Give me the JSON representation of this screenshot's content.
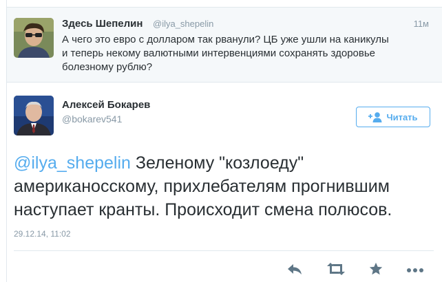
{
  "parent_tweet": {
    "display_name": "Здесь Шепелин",
    "handle": "@ilya_shepelin",
    "time": "11м",
    "text_line1": "А чего это евро с долларом так рванули? ЦБ уже ушли на каникулы",
    "text_line2": "и теперь некому валютными интервенциями сохранять здоровье",
    "text_line3": "болезному рублю?"
  },
  "main_tweet": {
    "display_name": "Алексей Бокарев",
    "handle": "@bokarev541",
    "follow_label": "Читать",
    "mention": "@ilya_shepelin",
    "text_after_mention": " Зеленому \"козлоеду\"",
    "text_line2": "американосскому, прихлебателям  прогнившим",
    "text_line3": "наступает кранты. Происходит смена полюсов.",
    "date": "29.12.14, 11:02"
  },
  "actions": {
    "reply_icon": "reply-icon",
    "retweet_icon": "retweet-icon",
    "favorite_icon": "star-icon",
    "more_icon": "more-icon"
  },
  "colors": {
    "accent": "#55acee",
    "text": "#292f33",
    "muted": "#8899a6",
    "icon": "#5e7686",
    "parent_bg": "#f5f8fa"
  }
}
